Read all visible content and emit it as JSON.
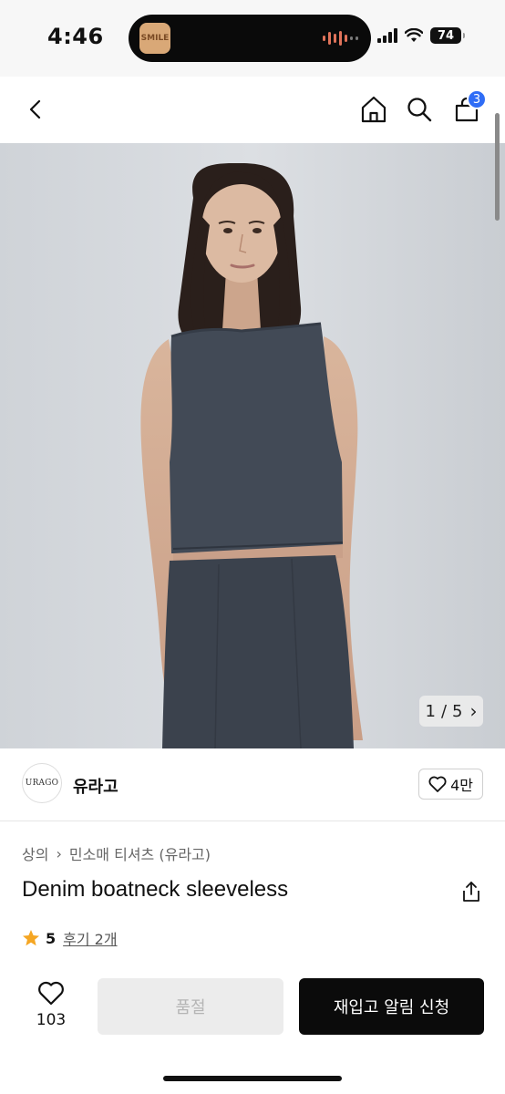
{
  "status_bar": {
    "time": "4:46",
    "battery": "74",
    "island_app_label": "SMILE"
  },
  "nav": {
    "cart_count": "3"
  },
  "gallery": {
    "current": "1",
    "separator": "/",
    "total": "5",
    "next_glyph": "›"
  },
  "brand": {
    "logo_text": "URAGO",
    "name": "유라고",
    "likes": "4만"
  },
  "breadcrumb": {
    "items": [
      "상의",
      "민소매 티셔츠 (유라고)"
    ],
    "separator": "›"
  },
  "product": {
    "title": "Denim boatneck sleeveless",
    "rating": "5",
    "reviews_label": "후기 2개"
  },
  "actions": {
    "wish_count": "103",
    "soldout_label": "품절",
    "restock_label": "재입고 알림 신청"
  },
  "colors": {
    "cart_badge": "#2f6df6",
    "star": "#f5a623",
    "primary_button": "#0b0b0b",
    "disabled_button": "#ececec"
  },
  "icons": [
    "back-icon",
    "home-icon",
    "search-icon",
    "cart-icon",
    "heart-icon",
    "share-icon",
    "star-icon",
    "chevron-right-icon"
  ]
}
